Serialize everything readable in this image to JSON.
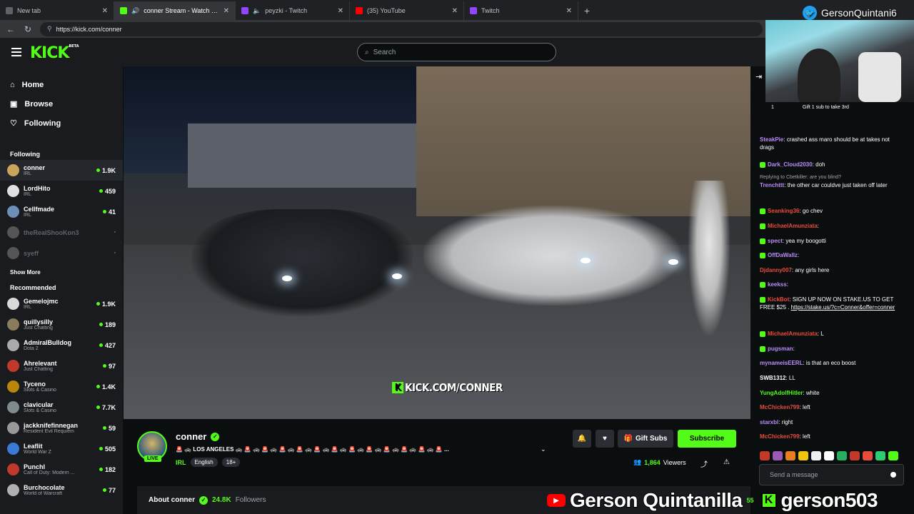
{
  "browser": {
    "tabs": [
      {
        "title": "New tab",
        "color": "#5f6368"
      },
      {
        "title": "conner Stream - Watch Live on Kick",
        "color": "#53fc18"
      },
      {
        "title": "peyzki - Twitch",
        "color": "#9146ff"
      },
      {
        "title": "(35) YouTube",
        "color": "#ff0000"
      },
      {
        "title": "Twitch",
        "color": "#9146ff"
      }
    ],
    "url": "https://kick.com/conner"
  },
  "site": {
    "logo": "KICK",
    "logo_badge": "BETA",
    "search_placeholder": "Search"
  },
  "sidebar": {
    "nav": [
      {
        "label": "Home",
        "icon": "home-icon"
      },
      {
        "label": "Browse",
        "icon": "browse-icon"
      },
      {
        "label": "Following",
        "icon": "heart-icon"
      }
    ],
    "following_header": "Following",
    "following": [
      {
        "name": "conner",
        "category": "IRL",
        "viewers": "1.9K",
        "color": "#c9a45c"
      },
      {
        "name": "LordHito",
        "category": "IRL",
        "viewers": "459",
        "color": "#e0e0e0"
      },
      {
        "name": "Cellfmade",
        "category": "IRL",
        "viewers": "41",
        "color": "#6d8fb8"
      },
      {
        "name": "theRealShooKon3",
        "category": "",
        "viewers": "",
        "color": "#555"
      },
      {
        "name": "syeff",
        "category": "",
        "viewers": "",
        "color": "#555"
      }
    ],
    "show_more": "Show More",
    "recommended_header": "Recommended",
    "recommended": [
      {
        "name": "Gemelojmc",
        "category": "IRL",
        "viewers": "1.9K",
        "color": "#d9d9d9"
      },
      {
        "name": "quillysilly",
        "category": "Just Chatting",
        "viewers": "189",
        "color": "#8a7b5d"
      },
      {
        "name": "AdmiralBulldog",
        "category": "Dota 2",
        "viewers": "427",
        "color": "#aaa"
      },
      {
        "name": "Ahrelevant",
        "category": "Just Chatting",
        "viewers": "97",
        "color": "#c0392b"
      },
      {
        "name": "Tyceno",
        "category": "Slots & Casino",
        "viewers": "1.4K",
        "color": "#b8860b"
      },
      {
        "name": "clavicular",
        "category": "Slots & Casino",
        "viewers": "7.7K",
        "color": "#7f8c8d"
      },
      {
        "name": "jackknifefinnegan",
        "category": "Resident Evil Requiem",
        "viewers": "59",
        "color": "#999"
      },
      {
        "name": "Leaflit",
        "category": "World War Z",
        "viewers": "505",
        "color": "#3a7bd5"
      },
      {
        "name": "PunchI",
        "category": "Call of Duty: Modern ...",
        "viewers": "182",
        "color": "#c0392b"
      },
      {
        "name": "Burchocolate",
        "category": "World of Warcraft",
        "viewers": "77",
        "color": "#b0b0b0"
      }
    ]
  },
  "video": {
    "watermark": "KICK.COM/CONNER"
  },
  "stream": {
    "name": "conner",
    "live": "LIVE",
    "title": "🚨 🚓 LOS ANGELES 🚓 🚨 🚓 🚨 🚓 🚨 🚓 🚨 🚓 🚨 🚓 🚨 🚓 🚨 🚓 🚨 🚓 🚨 🚓 🚨 🚓 🚨 🚓 🚨 ...",
    "category": "IRL",
    "tags": [
      "English",
      "18+"
    ],
    "gift_label": "Gift Subs",
    "subscribe_label": "Subscribe",
    "viewers_count": "1,864",
    "viewers_label": "Viewers",
    "about_label": "About conner",
    "followers_count": "24.8K",
    "followers_label": "Followers"
  },
  "chat": {
    "gift_left": "1",
    "gift_right": "Gift 1 sub to take 3rd",
    "messages": [
      {
        "user": "SteakPie",
        "color": "#b98cf7",
        "text": "crashed ass maro should be at takes not drags"
      },
      {
        "user": "Dark_Cloud2030",
        "color": "#b98cf7",
        "text": "doh"
      },
      {
        "reply": "Replying to Cbetkiller: are you blind?",
        "user": "Trenchttt",
        "color": "#b98cf7",
        "text": "the other car couldve just taken off later"
      },
      {
        "user": "Seanking36",
        "color": "#e94b3c",
        "text": "go chev"
      },
      {
        "user": "MichaelAmunziata",
        "color": "#e94b3c",
        "text": ""
      },
      {
        "user": "spect",
        "color": "#b98cf7",
        "text": "yea my boogotti"
      },
      {
        "user": "OffDaWallz",
        "color": "#b98cf7",
        "text": ""
      },
      {
        "user": "Djdanny007",
        "color": "#e94b3c",
        "text": "any girls here"
      },
      {
        "user": "keekss",
        "color": "#b98cf7",
        "text": ""
      },
      {
        "user": "KickBot",
        "color": "#e94b3c",
        "text": "SIGN UP NOW ON STAKE.US TO GET FREE $25 . ",
        "link": "https://stake.us/?c=Conner&offer=conner"
      },
      {
        "user": "MichaelAmunziata",
        "color": "#e94b3c",
        "text": "L"
      },
      {
        "user": "pugsman",
        "color": "#b98cf7",
        "text": ""
      },
      {
        "user": "mynameisEERL",
        "color": "#b98cf7",
        "text": "is that an eco boost"
      },
      {
        "user": "SWB1312",
        "color": "#ffffff",
        "text": "LL"
      },
      {
        "user": "YungAdolfHitler",
        "color": "#53fc18",
        "text": "white"
      },
      {
        "user": "McChicken799",
        "color": "#e94b3c",
        "text": "left"
      },
      {
        "user": "starxbl",
        "color": "#b98cf7",
        "text": "right"
      },
      {
        "user": "McChicken799",
        "color": "#e94b3c",
        "text": "left"
      }
    ],
    "input_placeholder": "Send a message"
  },
  "overlay": {
    "twitter_handle": "GersonQuintani6",
    "youtube_name": "Gerson Quintanilla",
    "kick_name": "gerson503",
    "count_partial": "55"
  },
  "colors": {
    "kick_green": "#53fc18",
    "bg": "#0b0e0f",
    "panel": "#191b1f"
  }
}
